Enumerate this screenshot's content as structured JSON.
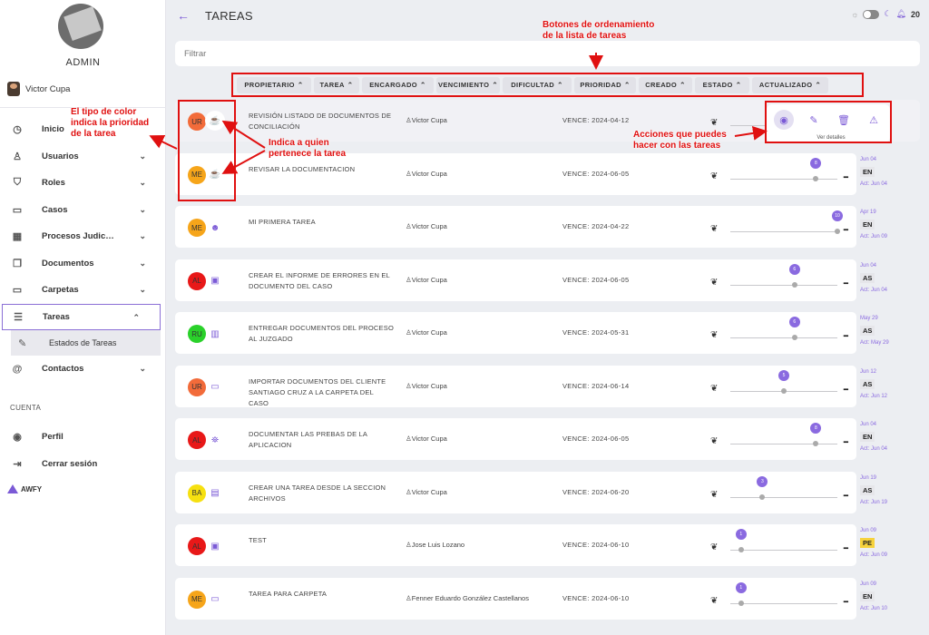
{
  "sidebar": {
    "admin_label": "ADMIN",
    "user_name": "Victor Cupa",
    "nav": [
      {
        "icon": "clock-icon",
        "glyph": "◷",
        "label": "Inicio",
        "chevron": ""
      },
      {
        "icon": "user-icon",
        "glyph": "♙",
        "label": "Usuarios",
        "chevron": "⌄"
      },
      {
        "icon": "roles-icon",
        "glyph": "⛉",
        "label": "Roles",
        "chevron": "⌄"
      },
      {
        "icon": "briefcase-icon",
        "glyph": "▭",
        "label": "Casos",
        "chevron": "⌄"
      },
      {
        "icon": "building-icon",
        "glyph": "▦",
        "label": "Procesos Judic…",
        "chevron": "⌄"
      },
      {
        "icon": "documents-icon",
        "glyph": "❐",
        "label": "Documentos",
        "chevron": "⌄"
      },
      {
        "icon": "folder-icon",
        "glyph": "▭",
        "label": "Carpetas",
        "chevron": "⌄"
      },
      {
        "icon": "list-icon",
        "glyph": "☰",
        "label": "Tareas",
        "chevron": "⌃"
      }
    ],
    "sub_item": {
      "icon": "wrench-icon",
      "glyph": "✎",
      "label": "Estados de Tareas"
    },
    "contacts": {
      "icon": "at-icon",
      "glyph": "@",
      "label": "Contactos",
      "chevron": "⌄"
    },
    "cuenta_label": "CUENTA",
    "cuenta_nav": [
      {
        "icon": "profile-icon",
        "glyph": "◉",
        "label": "Perfil"
      },
      {
        "icon": "logout-icon",
        "glyph": "⇥",
        "label": "Cerrar sesión"
      }
    ],
    "logo_text": "AWFY"
  },
  "header": {
    "back_glyph": "←",
    "title": "TAREAS",
    "notif_count": "20"
  },
  "search": {
    "placeholder": "Filtrar"
  },
  "sort_buttons": [
    "PROPIETARIO",
    "TAREA",
    "ENCARGADO",
    "VENCIMIENTO",
    "DIFICULTAD",
    "PRIORIDAD",
    "CREADO",
    "ESTADO",
    "ACTUALIZADO"
  ],
  "tasks": [
    {
      "prio": "UR",
      "color": "#f26b3a",
      "icon": "coffee-icon",
      "glyph": "☕",
      "title": "REVISIÓN LISTADO DE DOCUMENTOS DE CONCILIACIÓN",
      "owner": "Victor Cupa",
      "due": "VENCE: 2024-04-12",
      "level": null,
      "bubble": "",
      "created": "",
      "state": "",
      "updated": ""
    },
    {
      "prio": "ME",
      "color": "#f6a51a",
      "icon": "coffee-icon",
      "glyph": "☕",
      "title": "REVISAR LA DOCUMENTACION",
      "owner": "Victor Cupa",
      "due": "VENCE: 2024-06-05",
      "level": 0.8,
      "bubble": "8",
      "created": "Jun 04",
      "state": "EN",
      "updated": "Act: Jun 04"
    },
    {
      "prio": "ME",
      "color": "#f6a51a",
      "icon": "smile-icon",
      "glyph": "☻",
      "title": "MI PRIMERA TAREA",
      "owner": "Victor Cupa",
      "due": "VENCE: 2024-04-22",
      "level": 1.0,
      "bubble": "10",
      "created": "Apr 19",
      "state": "EN",
      "updated": "Act: Jun 09"
    },
    {
      "prio": "AL",
      "color": "#e81818",
      "icon": "briefcase-icon",
      "glyph": "▣",
      "title": "CREAR EL INFORME DE ERRORES EN EL DOCUMENTO DEL CASO",
      "owner": "Victor Cupa",
      "due": "VENCE: 2024-06-05",
      "level": 0.6,
      "bubble": "6",
      "created": "Jun 04",
      "state": "AS",
      "updated": "Act: Jun 04"
    },
    {
      "prio": "RU",
      "color": "#2ad12a",
      "icon": "building-icon",
      "glyph": "▥",
      "title": "ENTREGAR DOCUMENTOS DEL PROCESO AL JUZGADO",
      "owner": "Victor Cupa",
      "due": "VENCE: 2024-05-31",
      "level": 0.6,
      "bubble": "6",
      "created": "May 29",
      "state": "AS",
      "updated": "Act: May 29"
    },
    {
      "prio": "UR",
      "color": "#f26b3a",
      "icon": "folder-icon",
      "glyph": "▭",
      "title": "IMPORTAR DOCUMENTOS DEL CLIENTE SANTIAGO CRUZ A LA CARPETA DEL CASO",
      "owner": "Victor Cupa",
      "due": "VENCE: 2024-06-14",
      "level": 0.5,
      "bubble": "5",
      "created": "Jun 12",
      "state": "AS",
      "updated": "Act: Jun 12"
    },
    {
      "prio": "AL",
      "color": "#e81818",
      "icon": "shirt-icon",
      "glyph": "⛯",
      "title": "DOCUMENTAR LAS PREBAS DE LA APLICACION",
      "owner": "Victor Cupa",
      "due": "VENCE: 2024-06-05",
      "level": 0.8,
      "bubble": "8",
      "created": "Jun 04",
      "state": "EN",
      "updated": "Act: Jun 04"
    },
    {
      "prio": "BA",
      "color": "#f6e010",
      "icon": "archive-icon",
      "glyph": "▤",
      "title": "CREAR UNA TAREA DESDE LA SECCION ARCHIVOS",
      "owner": "Victor Cupa",
      "due": "VENCE: 2024-06-20",
      "level": 0.3,
      "bubble": "3",
      "created": "Jun 19",
      "state": "AS",
      "updated": "Act: Jun 19"
    },
    {
      "prio": "AL",
      "color": "#e81818",
      "icon": "briefcase-icon",
      "glyph": "▣",
      "title": "TEST",
      "owner": "Jose Luis Lozano",
      "due": "VENCE: 2024-06-10",
      "level": 0.1,
      "bubble": "1",
      "created": "Jun 09",
      "state": "PE",
      "updated": "Act: Jun 09"
    },
    {
      "prio": "ME",
      "color": "#f6a51a",
      "icon": "folder-icon",
      "glyph": "▭",
      "title": "TAREA PARA CARPETA",
      "owner": "Fenner Eduardo González Castellanos",
      "due": "VENCE: 2024-06-10",
      "level": 0.1,
      "bubble": "1",
      "created": "Jun 09",
      "state": "EN",
      "updated": "Act: Jun 10"
    }
  ],
  "actions": {
    "caption": "Ver detalles",
    "buttons": [
      {
        "name": "view-button",
        "icon": "eye-icon",
        "glyph": "◉"
      },
      {
        "name": "edit-button",
        "icon": "edit-icon",
        "glyph": "✎"
      },
      {
        "name": "delete-button",
        "icon": "trash-icon",
        "glyph": "🗑"
      },
      {
        "name": "alert-button",
        "icon": "warning-icon",
        "glyph": "⚠"
      }
    ]
  },
  "annotations": {
    "sort": "Botones de ordenamiento\nde la lista de tareas",
    "color": "El tipo de color\nindica la prioridad\nde la tarea",
    "owner": "Indica a quien\npertenece la tarea",
    "actions": "Acciones que puedes\nhacer con las tareas"
  },
  "colors": {
    "accent": "#7b5ad6",
    "annotation": "#e01010"
  }
}
